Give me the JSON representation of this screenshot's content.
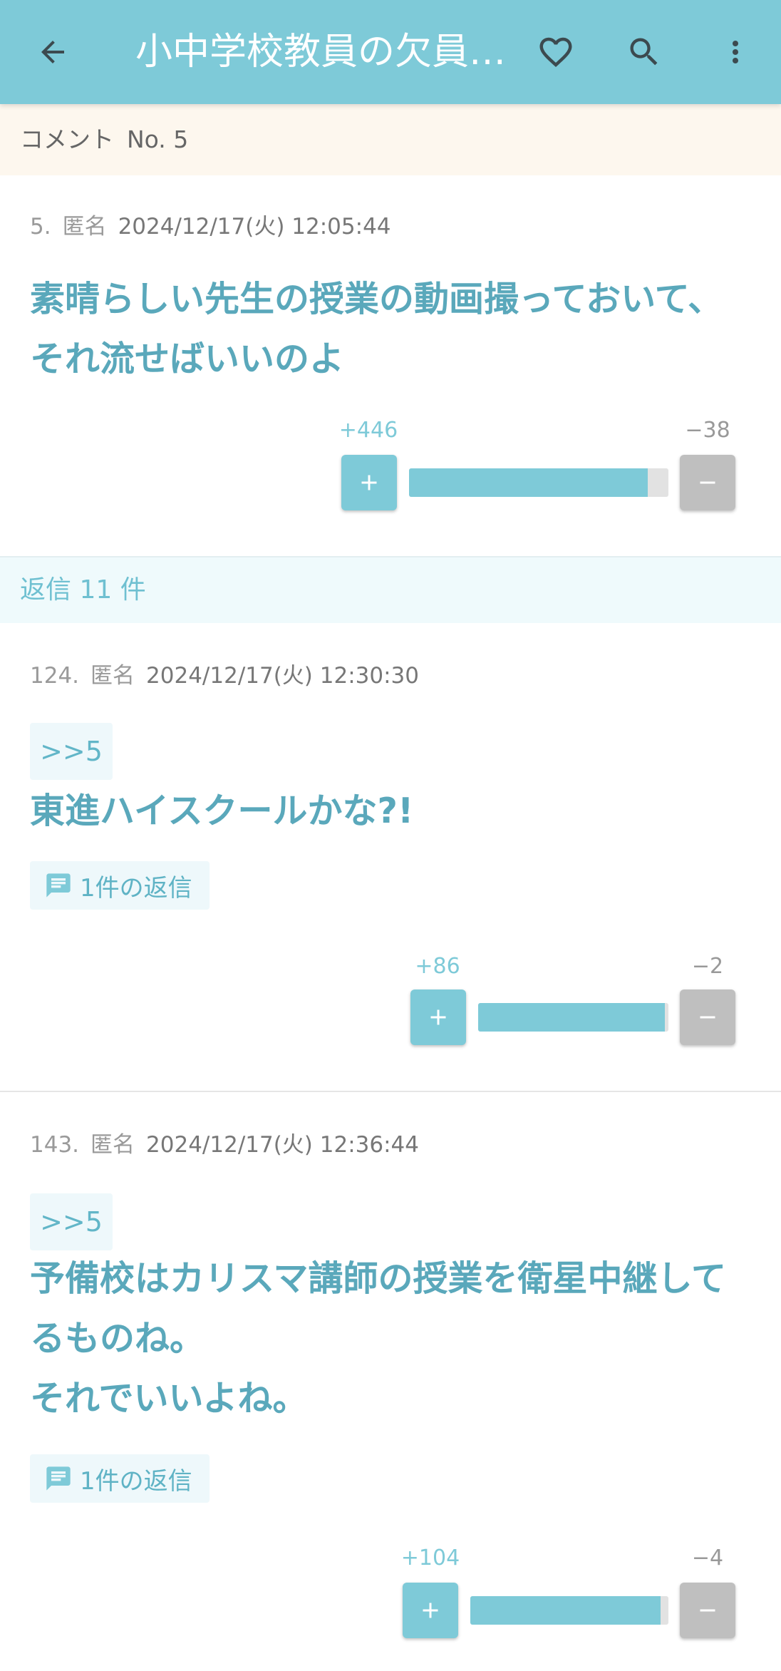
{
  "appbar": {
    "title": "小中学校教員の欠員…",
    "icons": [
      "back-arrow-icon",
      "heart-icon",
      "search-icon",
      "more-vert-icon"
    ]
  },
  "subheader": {
    "label": "コメント",
    "number": "No. 5"
  },
  "parent": {
    "num": "5.",
    "author": "匿名",
    "date": "2024/12/17(火) 12:05:44",
    "text": "素晴らしい先生の授業の動画撮っておいて、それ流せばいいのよ",
    "plus": "+446",
    "minus": "−38",
    "ratio": 0.92
  },
  "replies_header": "返信 11 件",
  "replies": [
    {
      "num": "124.",
      "author": "匿名",
      "date": "2024/12/17(火) 12:30:30",
      "tag": ">>5",
      "text": "東進ハイスクールかな?!",
      "reply_count": "1件の返信",
      "plus": "+86",
      "minus": "−2",
      "ratio": 0.98
    },
    {
      "num": "143.",
      "author": "匿名",
      "date": "2024/12/17(火) 12:36:44",
      "tag": ">>5",
      "text": "予備校はカリスマ講師の授業を衛星中継してるものね。\nそれでいいよね。",
      "reply_count": "1件の返信",
      "plus": "+104",
      "minus": "−4",
      "ratio": 0.96
    }
  ],
  "colors": {
    "accent": "#7ecad8",
    "text_accent": "#5aa8bb",
    "minus": "#bfbfbf"
  }
}
